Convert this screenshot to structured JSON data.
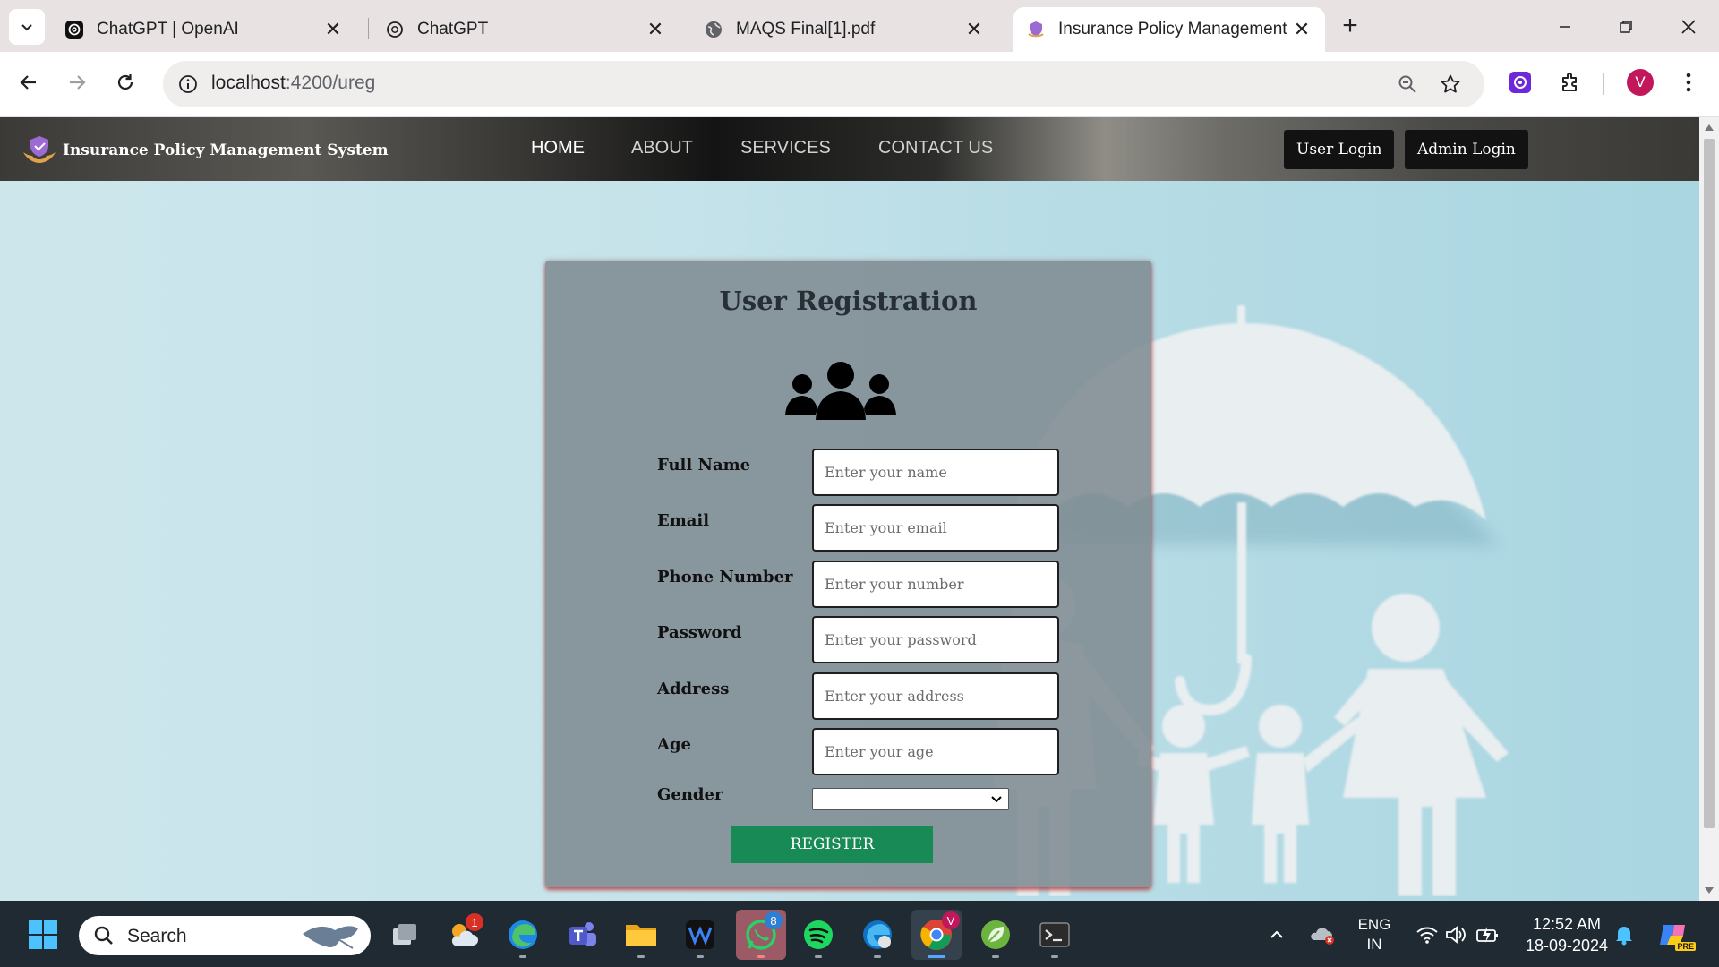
{
  "browser": {
    "tabs": [
      {
        "title": "ChatGPT | OpenAI",
        "icon": "openai-icon",
        "active": false
      },
      {
        "title": "ChatGPT",
        "icon": "openai-icon",
        "active": false
      },
      {
        "title": "MAQS Final[1].pdf",
        "icon": "globe-icon",
        "active": false
      },
      {
        "title": "Insurance Policy Management",
        "icon": "site-shield-icon",
        "active": true
      }
    ],
    "url_host": "localhost",
    "url_path": ":4200/ureg",
    "profile_initial": "V"
  },
  "app": {
    "brand": "Insurance Policy Management System",
    "menu": [
      "HOME",
      "ABOUT",
      "SERVICES",
      "CONTACT US"
    ],
    "user_login": "User Login",
    "admin_login": "Admin Login"
  },
  "form": {
    "title": "User Registration",
    "fields": [
      {
        "label": "Full Name",
        "placeholder": "Enter your name"
      },
      {
        "label": "Email",
        "placeholder": "Enter your email"
      },
      {
        "label": "Phone Number",
        "placeholder": "Enter your number"
      },
      {
        "label": "Password",
        "placeholder": "Enter your password"
      },
      {
        "label": "Address",
        "placeholder": "Enter your address"
      },
      {
        "label": "Age",
        "placeholder": "Enter your age"
      }
    ],
    "gender_label": "Gender",
    "gender_value": "",
    "register": "REGISTER"
  },
  "taskbar": {
    "search": "Search",
    "weather_badge": "1",
    "whatsapp_badge": "8",
    "chrome_badge": "V",
    "lang_line1": "ENG",
    "lang_line2": "IN",
    "time": "12:52 AM",
    "date": "18-09-2024",
    "copilot_label": "PRE"
  },
  "colors": {
    "register_button": "#178a56",
    "card_bg": "#808c92",
    "nav_button": "#121212",
    "profile_avatar": "#c2185b"
  }
}
